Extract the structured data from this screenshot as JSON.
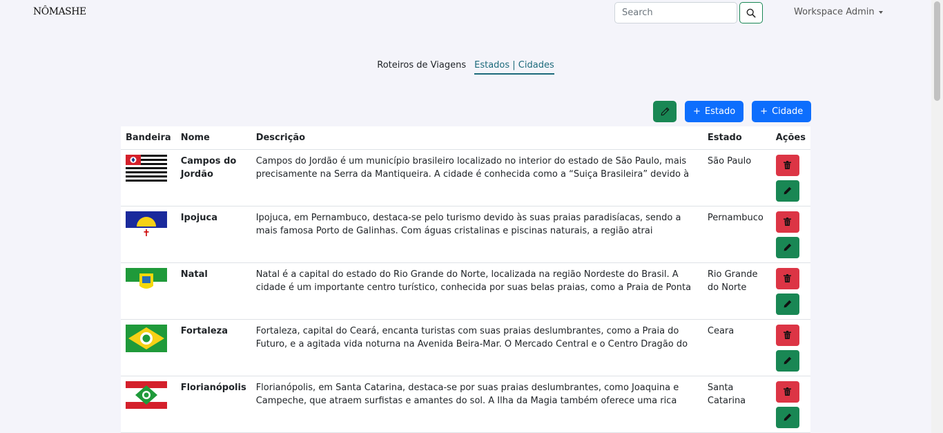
{
  "brand": "NÔMASHE",
  "search": {
    "placeholder": "Search",
    "value": ""
  },
  "user_menu": {
    "label": "Workspace Admin"
  },
  "tabs": [
    {
      "label": "Roteiros de Viagens",
      "active": false
    },
    {
      "label": "Estados | Cidades",
      "active": true
    }
  ],
  "toolbar": {
    "add_state": "Estado",
    "add_city": "Cidade"
  },
  "table": {
    "headers": {
      "flag": "Bandeira",
      "name": "Nome",
      "description": "Descrição",
      "state": "Estado",
      "actions": "Ações"
    },
    "rows": [
      {
        "flag": "sao-paulo",
        "name": "Campos do Jordão",
        "description": "Campos do Jordão é um município brasileiro localizado no interior do estado de São Paulo, mais precisamente na Serra da Mantiqueira. A cidade é conhecida como a “Suiça Brasileira” devido à sua",
        "state": "São Paulo"
      },
      {
        "flag": "pernambuco",
        "name": "Ipojuca",
        "description": "Ipojuca, em Pernambuco, destaca-se pelo turismo devido às suas praias paradisíacas, sendo a mais famosa Porto de Galinhas. Com águas cristalinas e piscinas naturais, a região atrai visitantes em busca",
        "state": "Pernambuco"
      },
      {
        "flag": "rio-grande-do-norte",
        "name": "Natal",
        "description": "Natal é a capital do estado do Rio Grande do Norte, localizada na região Nordeste do Brasil. A cidade é um importante centro turístico, conhecida por suas belas praias, como a Praia de Ponta Negra, a Praia",
        "state": "Rio Grande do Norte"
      },
      {
        "flag": "ceara",
        "name": "Fortaleza",
        "description": "Fortaleza, capital do Ceará, encanta turistas com suas praias deslumbrantes, como a Praia do Futuro, e a agitada vida noturna na Avenida Beira-Mar. O Mercado Central e o Centro Dragão do Mar são pontos",
        "state": "Ceara"
      },
      {
        "flag": "santa-catarina",
        "name": "Florianópolis",
        "description": "Florianópolis, em Santa Catarina, destaca-se por suas praias deslumbrantes, como Joaquina e Campeche, que atraem surfistas e amantes do sol. A Ilha da Magia também oferece uma rica cultura açoriana,",
        "state": "Santa Catarina"
      }
    ]
  },
  "colors": {
    "green": "#198754",
    "blue": "#0d6efd",
    "red": "#dc3545",
    "tab_active": "#1c6a7b"
  }
}
